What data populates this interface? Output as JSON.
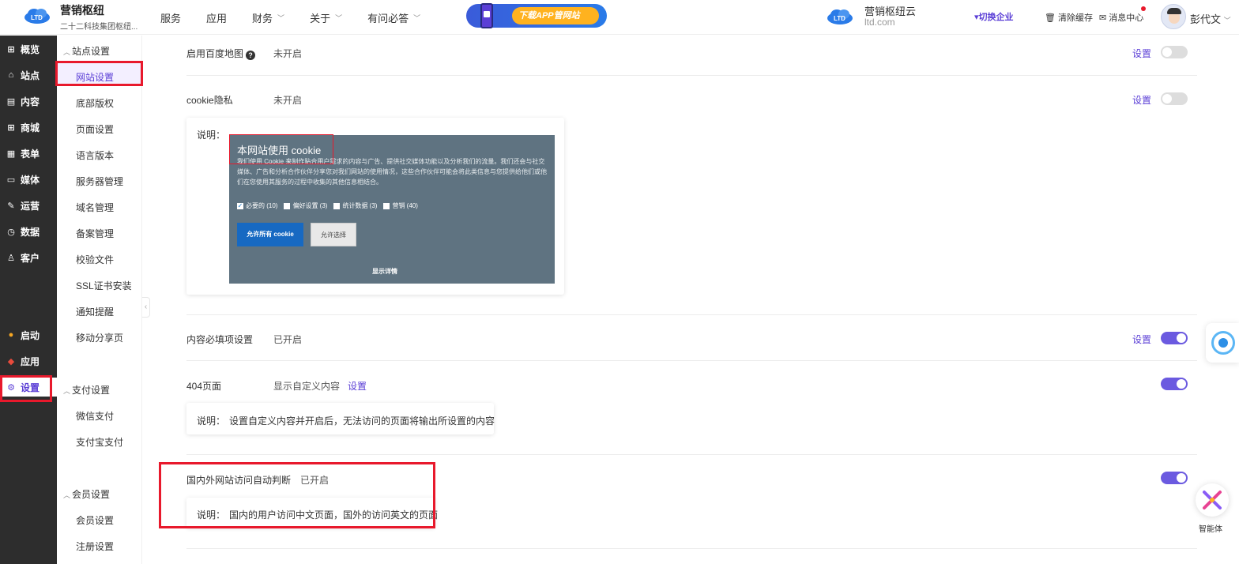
{
  "header": {
    "brand_title": "营销枢纽",
    "brand_sub": "二十二科技集团枢纽...",
    "nav": [
      {
        "label": "服务",
        "has_menu": false
      },
      {
        "label": "应用",
        "has_menu": false
      },
      {
        "label": "财务",
        "has_menu": true
      },
      {
        "label": "关于",
        "has_menu": true
      },
      {
        "label": "有问必答",
        "has_menu": true
      }
    ],
    "banner_text": "下载APP管网站",
    "right_brand_title": "营销枢纽云",
    "right_brand_domain": "ltd.com",
    "switch_enterprise": "▾切换企业",
    "clear_cache": "清除缓存",
    "message_center": "消息中心",
    "user_name": "彭代文"
  },
  "sidebar": {
    "items": [
      {
        "icon": "shop-icon",
        "glyph": "🛒",
        "label": "概览"
      },
      {
        "icon": "home-icon",
        "glyph": "⌂",
        "label": "站点"
      },
      {
        "icon": "document-icon",
        "glyph": "▤",
        "label": "内容"
      },
      {
        "icon": "cart-icon",
        "glyph": "🛒",
        "label": "商城"
      },
      {
        "icon": "form-icon",
        "glyph": "▦",
        "label": "表单"
      },
      {
        "icon": "media-icon",
        "glyph": "▭",
        "label": "媒体"
      },
      {
        "icon": "rocket-icon",
        "glyph": "✎",
        "label": "运营"
      },
      {
        "icon": "clock-icon",
        "glyph": "◷",
        "label": "数据"
      },
      {
        "icon": "user-icon",
        "glyph": "♙",
        "label": "客户"
      },
      {
        "icon": "launch-icon",
        "glyph": "●",
        "label": "启动"
      },
      {
        "icon": "apps-icon",
        "glyph": "◆",
        "label": "应用"
      },
      {
        "icon": "gear-icon",
        "glyph": "⚙",
        "label": "设置"
      }
    ]
  },
  "subsidebar": {
    "group_site": "站点设置",
    "site_items": [
      "网站设置",
      "底部版权",
      "页面设置",
      "语言版本",
      "服务器管理",
      "域名管理",
      "备案管理",
      "校验文件",
      "SSL证书安装",
      "通知提醒",
      "移动分享页"
    ],
    "group_pay": "支付设置",
    "pay_items": [
      "微信支付",
      "支付宝支付"
    ],
    "group_member": "会员设置",
    "member_items": [
      "会员设置",
      "注册设置"
    ]
  },
  "content": {
    "baidu_map": {
      "label": "启用百度地图",
      "status": "未开启",
      "link": "设置",
      "enabled": false
    },
    "cookie": {
      "label": "cookie隐私",
      "status": "未开启",
      "link": "设置",
      "enabled": false,
      "note_label": "说明："
    },
    "cookie_preview": {
      "title": "本网站使用 cookie",
      "desc": "我们使用 Cookie 来制作贴合用户需求的内容与广告、提供社交媒体功能以及分析我们的流量。我们还会与社交媒体、广告和分析合作伙伴分享您对我们网站的使用情况，这些合作伙伴可能会将此类信息与您提供给他们或他们在您使用其服务的过程中收集的其他信息相结合。",
      "checks": [
        {
          "label": "必要的 (10)",
          "checked": true
        },
        {
          "label": "偏好设置 (3)",
          "checked": false
        },
        {
          "label": "统计数据 (3)",
          "checked": false
        },
        {
          "label": "营销 (40)",
          "checked": false
        }
      ],
      "allow_all": "允许所有 cookie",
      "allow_selected": "允许选择",
      "show_details": "显示详情"
    },
    "required_fields": {
      "label": "内容必填项设置",
      "status": "已开启",
      "link": "设置",
      "enabled": true
    },
    "page_404": {
      "label": "404页面",
      "status": "显示自定义内容",
      "link": "设置",
      "enabled": true,
      "note_label": "说明：",
      "note": "设置自定义内容并开启后，无法访问的页面将输出所设置的内容"
    },
    "geo_redirect": {
      "label": "国内外网站访问自动判断",
      "status": "已开启",
      "enabled": true,
      "note_label": "说明：",
      "note": "国内的用户访问中文页面，国外的访问英文的页面"
    }
  },
  "floating": {
    "ai_label": "智能体"
  },
  "colors": {
    "accent": "#5b3fd6",
    "highlight_red": "#e8192c",
    "sidebar_bg": "#2d2d2d"
  }
}
